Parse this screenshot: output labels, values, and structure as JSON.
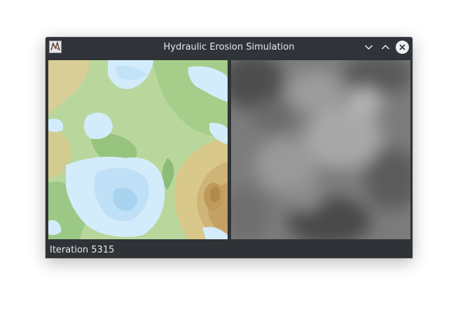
{
  "window": {
    "title": "Hydraulic Erosion Simulation",
    "app_icon": "graph-icon",
    "controls": [
      {
        "name": "minimize",
        "icon": "chevron-down-icon"
      },
      {
        "name": "maximize",
        "icon": "chevron-up-icon"
      },
      {
        "name": "close",
        "icon": "close-icon"
      }
    ]
  },
  "views": {
    "left": "colored-terrain-map",
    "right": "grayscale-heightmap"
  },
  "status": {
    "text": "Iteration 5315"
  },
  "colors": {
    "titlebar": "#30343a",
    "window_bg": "#2f3337",
    "water": "#d3ecfb",
    "deep_water": "#a8d4f0",
    "lowland_green": "#8fc27a",
    "mid_green": "#b7d699",
    "highland_tan": "#d8c98a",
    "peak_brown": "#bf9a5a",
    "height_light": "#b4b4b4",
    "height_dark": "#4a4a4a"
  }
}
